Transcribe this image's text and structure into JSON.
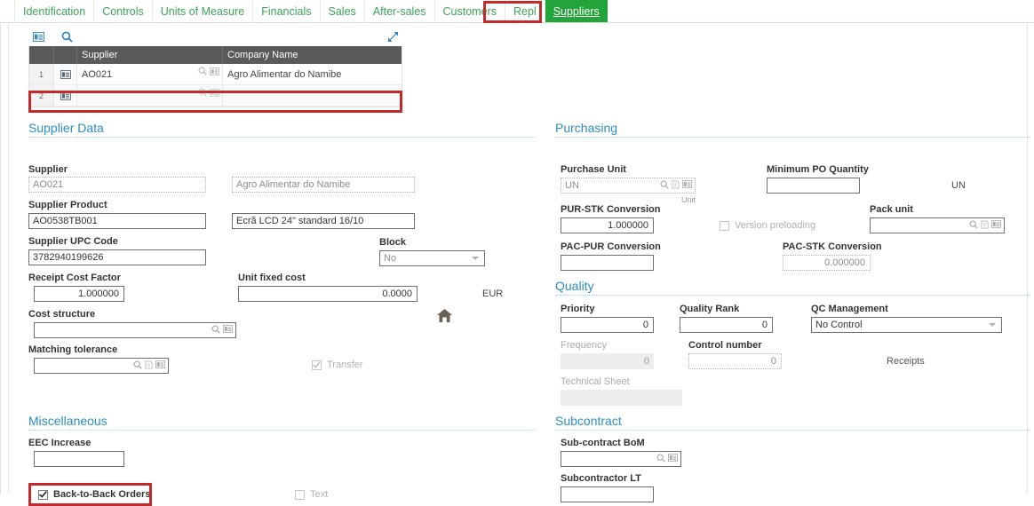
{
  "tabs": [
    {
      "label": "Identification",
      "active": false
    },
    {
      "label": "Controls",
      "active": false
    },
    {
      "label": "Units of Measure",
      "active": false
    },
    {
      "label": "Financials",
      "active": false
    },
    {
      "label": "Sales",
      "active": false
    },
    {
      "label": "After-sales",
      "active": false
    },
    {
      "label": "Customers",
      "active": false
    },
    {
      "label": "Repl",
      "active": false
    },
    {
      "label": "Suppliers",
      "active": true
    }
  ],
  "grid": {
    "toolbar": {
      "detail_icon": "detail-list-icon",
      "search_icon": "search-icon",
      "expand_icon": "expand-diagonal-icon"
    },
    "columns": [
      "",
      "",
      "Supplier",
      "Company Name"
    ],
    "rows": [
      {
        "num": "1",
        "supplier": "AO021",
        "company": "Agro Alimentar do Namibe",
        "highlighted": true
      },
      {
        "num": "2",
        "supplier": "",
        "company": "",
        "highlighted": false
      }
    ]
  },
  "supplier_data": {
    "title": "Supplier Data",
    "supplier_label": "Supplier",
    "supplier_value": "AO021",
    "supplier_name_value": "Agro Alimentar do Namibe",
    "supplier_product_label": "Supplier Product",
    "supplier_product_value": "AO0538TB001",
    "supplier_product_desc_value": "Ecrã LCD 24\" standard 16/10",
    "supplier_upc_label": "Supplier UPC Code",
    "supplier_upc_value": "3782940199626",
    "block_label": "Block",
    "block_value": "No",
    "receipt_cost_factor_label": "Receipt Cost Factor",
    "receipt_cost_factor_value": "1.000000",
    "unit_fixed_cost_label": "Unit fixed cost",
    "unit_fixed_cost_value": "0.0000",
    "currency_suffix": "EUR",
    "cost_structure_label": "Cost structure",
    "cost_structure_value": "",
    "matching_tolerance_label": "Matching tolerance",
    "matching_tolerance_value": "",
    "transfer_label": "Transfer",
    "transfer_checked": true,
    "home_icon": "home-icon"
  },
  "purchasing": {
    "title": "Purchasing",
    "purchase_unit_label": "Purchase Unit",
    "purchase_unit_value": "UN",
    "purchase_unit_sub": "Unit",
    "minimum_po_qty_label": "Minimum PO Quantity",
    "minimum_po_qty_value": "",
    "minimum_po_qty_suffix": "UN",
    "pur_stk_label": "PUR-STK Conversion",
    "pur_stk_value": "1.000000",
    "version_preloading_label": "Version preloading",
    "version_preloading_checked": false,
    "pack_unit_label": "Pack unit",
    "pack_unit_value": "",
    "pac_pur_label": "PAC-PUR Conversion",
    "pac_pur_value": "",
    "pac_stk_label": "PAC-STK Conversion",
    "pac_stk_value": "0.000000"
  },
  "quality": {
    "title": "Quality",
    "priority_label": "Priority",
    "priority_value": "0",
    "quality_rank_label": "Quality Rank",
    "quality_rank_value": "0",
    "qc_management_label": "QC Management",
    "qc_management_value": "No Control",
    "frequency_label": "Frequency",
    "frequency_value": "0",
    "control_number_label": "Control number",
    "control_number_value": "0",
    "receipts_label": "Receipts",
    "technical_sheet_label": "Technical Sheet",
    "technical_sheet_value": ""
  },
  "miscellaneous": {
    "title": "Miscellaneous",
    "eec_increase_label": "EEC Increase",
    "eec_increase_value": "",
    "back_to_back_label": "Back-to-Back Orders",
    "back_to_back_checked": true,
    "text_label": "Text",
    "text_checked": false
  },
  "subcontract": {
    "title": "Subcontract",
    "subcontract_bom_label": "Sub-contract BoM",
    "subcontract_bom_value": "",
    "subcontractor_lt_label": "Subcontractor LT",
    "subcontractor_lt_value": ""
  },
  "colors": {
    "tab_green": "#23a43a",
    "tab_text_green": "#3ea35a",
    "highlight_red": "#c32b2b",
    "section_blue": "#2d8ec4",
    "grid_header_gray": "#5a5a5a"
  }
}
